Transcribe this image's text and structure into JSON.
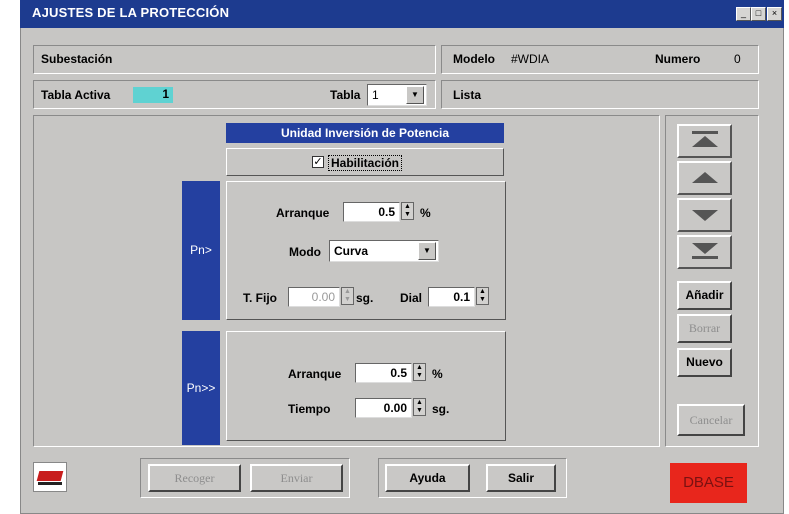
{
  "window": {
    "title": "AJUSTES DE LA PROTECCIÓN",
    "controls": [
      "_",
      "□",
      "×"
    ]
  },
  "header": {
    "subestacion_label": "Subestación",
    "modelo_label": "Modelo",
    "modelo_value": "#WDIA",
    "numero_label": "Numero",
    "numero_value": "0",
    "tabla_activa_label": "Tabla Activa",
    "tabla_activa_value": "1",
    "tabla_label": "Tabla",
    "tabla_value": "1",
    "lista_label": "Lista"
  },
  "unit": {
    "title": "Unidad Inversión de Potencia",
    "habilitacion_label": "Habilitación",
    "habilitacion_checked": true
  },
  "pn1": {
    "label": "Pn>",
    "arranque_label": "Arranque",
    "arranque_value": "0.5",
    "arranque_unit": "%",
    "modo_label": "Modo",
    "modo_value": "Curva",
    "tfijo_label": "T. Fijo",
    "tfijo_value": "0.00",
    "tfijo_unit": "sg.",
    "dial_label": "Dial",
    "dial_value": "0.1"
  },
  "pn2": {
    "label": "Pn>>",
    "arranque_label": "Arranque",
    "arranque_value": "0.5",
    "arranque_unit": "%",
    "tiempo_label": "Tiempo",
    "tiempo_value": "0.00",
    "tiempo_unit": "sg."
  },
  "side": {
    "anadir": "Añadir",
    "borrar": "Borrar",
    "nuevo": "Nuevo",
    "cancelar": "Cancelar"
  },
  "footer": {
    "recoger": "Recoger",
    "enviar": "Enviar",
    "ayuda": "Ayuda",
    "salir": "Salir",
    "dbase": "DBASE",
    "dbase_color": "#e8261c"
  }
}
